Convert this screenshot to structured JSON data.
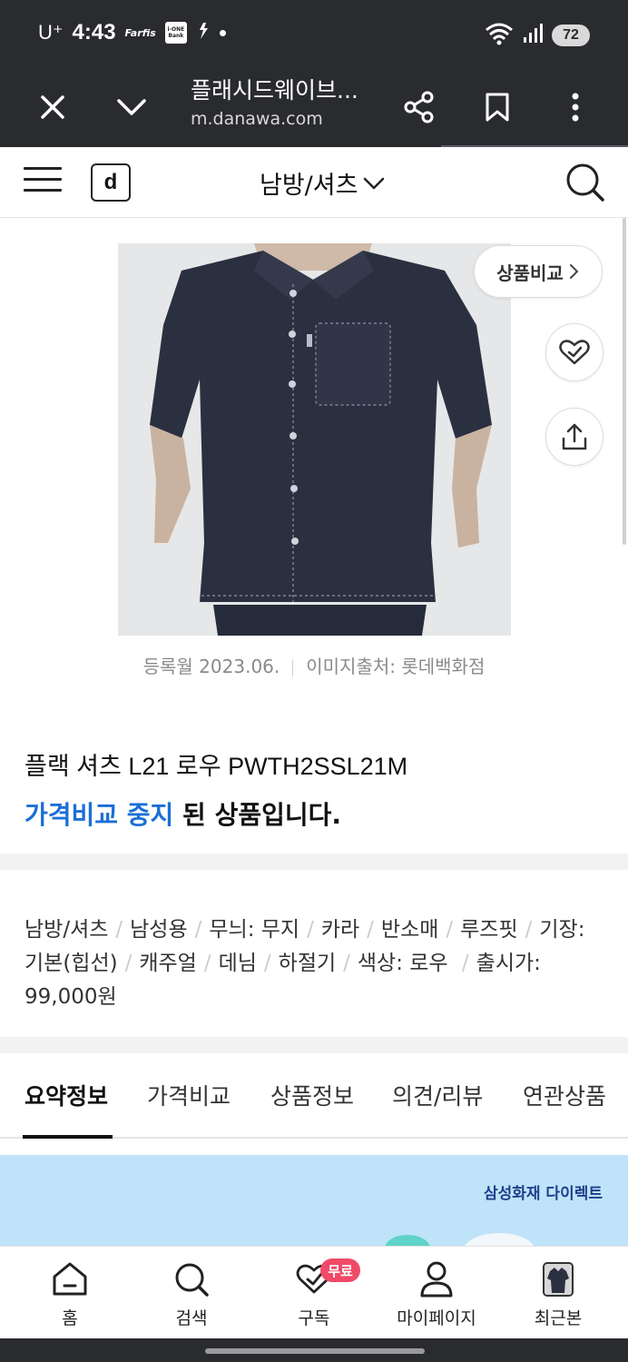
{
  "status_bar": {
    "carrier": "U⁺",
    "time": "4:43",
    "mini_icon_text": "Farfis",
    "bank_icon_text": "i-ONE Bank",
    "battery": "72"
  },
  "browser": {
    "page_title": "플래시드웨이브...",
    "url": "m.danawa.com"
  },
  "header": {
    "logo": "d",
    "category": "남방/셔츠"
  },
  "product": {
    "compare_label": "상품비교",
    "registered": "등록월 2023.06.",
    "image_source": "이미지출처: 롯데백화점",
    "name": "플랙 셔츠 L21 로우 PWTH2SSL21M",
    "status_highlight": "가격비교 중지",
    "status_rest": " 된 상품입니다.",
    "specs": [
      "남방/셔츠",
      "남성용",
      "무늬: 무지",
      "카라",
      "반소매",
      "루즈핏",
      "기장: 기본(힙선)",
      "캐주얼",
      "데님",
      "하절기",
      "색상: 로우 ",
      "출시가: 99,000원"
    ]
  },
  "tabs": [
    {
      "label": "요약정보"
    },
    {
      "label": "가격비교"
    },
    {
      "label": "상품정보"
    },
    {
      "label": "의견/리뷰"
    },
    {
      "label": "연관상품"
    }
  ],
  "banner": {
    "text": "삼성화재 다이렉트"
  },
  "bottom_nav": [
    {
      "label": "홈",
      "icon": "home-icon"
    },
    {
      "label": "검색",
      "icon": "search-icon"
    },
    {
      "label": "구독",
      "icon": "heart-check-icon"
    },
    {
      "label": "마이페이지",
      "icon": "person-icon"
    },
    {
      "label": "최근본",
      "icon": "recent-thumbnail"
    }
  ],
  "free_badge": "무료",
  "colors": {
    "accent_blue": "#1b6fd6",
    "badge_pink": "#f04a68",
    "chrome_dark": "#2a2b2f"
  }
}
